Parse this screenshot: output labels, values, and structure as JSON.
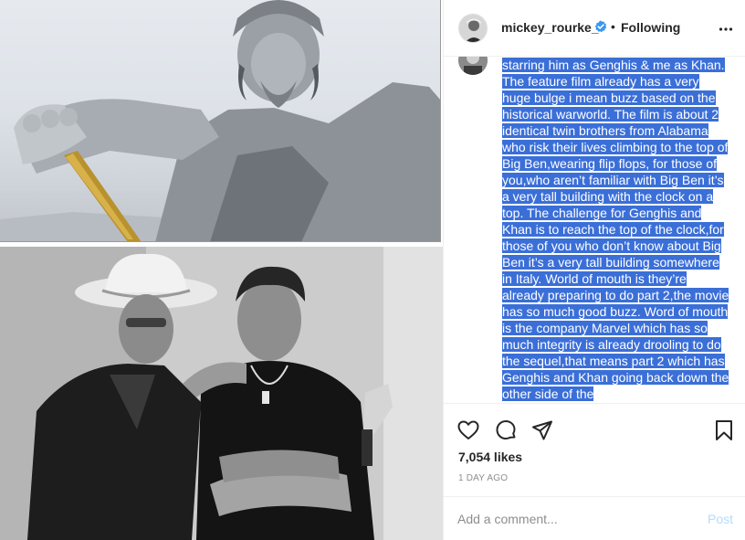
{
  "post": {
    "username": "mickey_rourke_",
    "separator": "•",
    "follow_status": "Following",
    "caption": "starring him as Genghis & me as Khan. The feature film already has a very huge bulge i mean buzz based on the historical warworld. The film is about 2 identical twin brothers from Alabama who risk their lives climbing to the top of Big Ben,wearing flip flops, for those of you,who aren’t familiar with Big Ben it’s a very tall building with the clock on a top. The challenge for Genghis and Khan is to reach the top of the clock,for those of you who don’t know about Big Ben it’s a very tall building somewhere in Italy. World of mouth is they’re already preparing to do part 2,the movie has so much good buzz. Word of mouth is the company Marvel which has so much integrity is already drooling to do the sequel,that means part 2 which has Genghis and Khan going back down the other side of the",
    "likes": "7,054 likes",
    "time_ago": "1 DAY AGO"
  },
  "comment_box": {
    "placeholder": "Add a comment...",
    "post_label": "Post"
  },
  "icons": {
    "verified": "verified-badge-icon",
    "more": "more-options-icon",
    "like": "heart-icon",
    "comment": "comment-bubble-icon",
    "share": "paper-plane-icon",
    "save": "bookmark-icon"
  },
  "colors": {
    "selection_highlight": "#3b6fd8",
    "verified_blue": "#3897f0",
    "post_button_disabled": "#b3dbff",
    "muted_text": "#8e8e8e"
  }
}
